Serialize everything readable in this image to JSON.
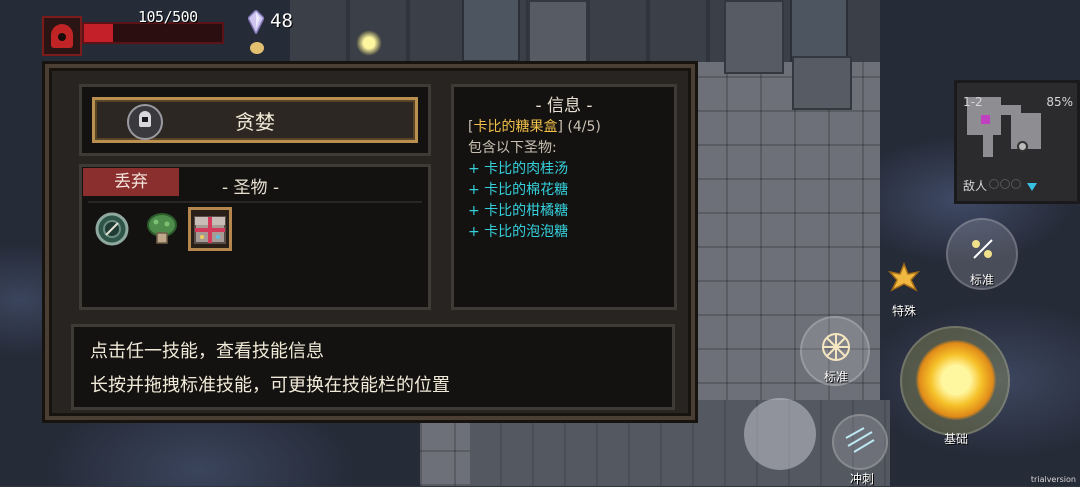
{
  "hud": {
    "hp_text": "105/500",
    "hp_ratio": 0.21,
    "gem_count": "48"
  },
  "dialog": {
    "character_name": "贪婪",
    "discard_label": "丢弃",
    "relics_title": "- 圣物 -",
    "info_title": "- 信息 -",
    "info": {
      "bracket_open": "[",
      "item_name": "卡比的糖果盒",
      "bracket_close": "]",
      "item_count": "(4/5)",
      "contains_label": "包含以下圣物:",
      "contents": [
        "+ 卡比的肉桂汤",
        "+ 卡比的棉花糖",
        "+ 卡比的柑橘糖",
        "+ 卡比的泡泡糖"
      ]
    },
    "tips": [
      "点击任一技能，查看技能信息",
      "长按并拖拽标准技能，可更换在技能栏的位置"
    ],
    "relic_icons": [
      "compass-relic-icon",
      "mushroom-relic-icon",
      "candy-box-relic-icon"
    ]
  },
  "minimap": {
    "level": "1-2",
    "explored": "85%",
    "enemies_label": "敌人"
  },
  "skills": {
    "standard_top": "标准",
    "special": "特殊",
    "standard_left": "标准",
    "basic": "基础",
    "dash": "冲刺"
  },
  "colors": {
    "accent_gold": "#f0c04a",
    "accent_cyan": "#35d0dc",
    "hp_red": "#c4202a",
    "discard_red": "#8a2e2e"
  },
  "version": "trialversion"
}
